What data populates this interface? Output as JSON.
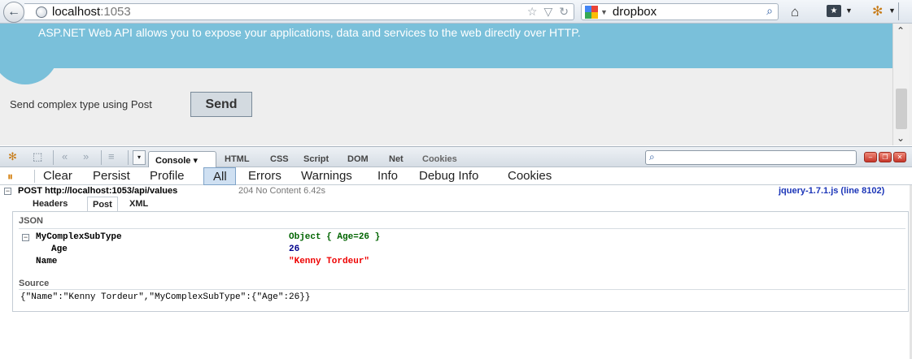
{
  "browser": {
    "url_host": "localhost",
    "url_port": ":1053",
    "search_engine_icon": "google-icon",
    "search_text": "dropbox"
  },
  "page": {
    "banner_text": "ASP.NET Web API allows you to expose your applications, data and services to the web directly over HTTP.",
    "send_label": "Send complex type using Post",
    "send_button": "Send",
    "banner_color": "#7ac0da"
  },
  "firebug": {
    "panel_tabs": [
      "Console",
      "HTML",
      "CSS",
      "Script",
      "DOM",
      "Net",
      "Cookies"
    ],
    "active_panel": "Console",
    "filters": {
      "clear": "Clear",
      "persist": "Persist",
      "profile": "Profile",
      "all": "All",
      "errors": "Errors",
      "warnings": "Warnings",
      "info": "Info",
      "debug_info": "Debug Info",
      "cookies": "Cookies"
    },
    "request": {
      "line": "POST http://localhost:1053/api/values",
      "status": "204 No Content 6.42s",
      "source": "jquery-1.7.1.js (line 8102)",
      "tabs": [
        "Headers",
        "Post",
        "XML"
      ],
      "active_tab": "Post"
    },
    "json_section": {
      "title": "JSON",
      "rows": [
        {
          "name": "MyComplexSubType",
          "value": "Object { Age=26 }"
        },
        {
          "name": "Age",
          "value": "26"
        },
        {
          "name": "Name",
          "value": "\"Kenny Tordeur\""
        }
      ]
    },
    "source_section": {
      "title": "Source",
      "text": "{\"Name\":\"Kenny Tordeur\",\"MyComplexSubType\":{\"Age\":26}}"
    }
  }
}
